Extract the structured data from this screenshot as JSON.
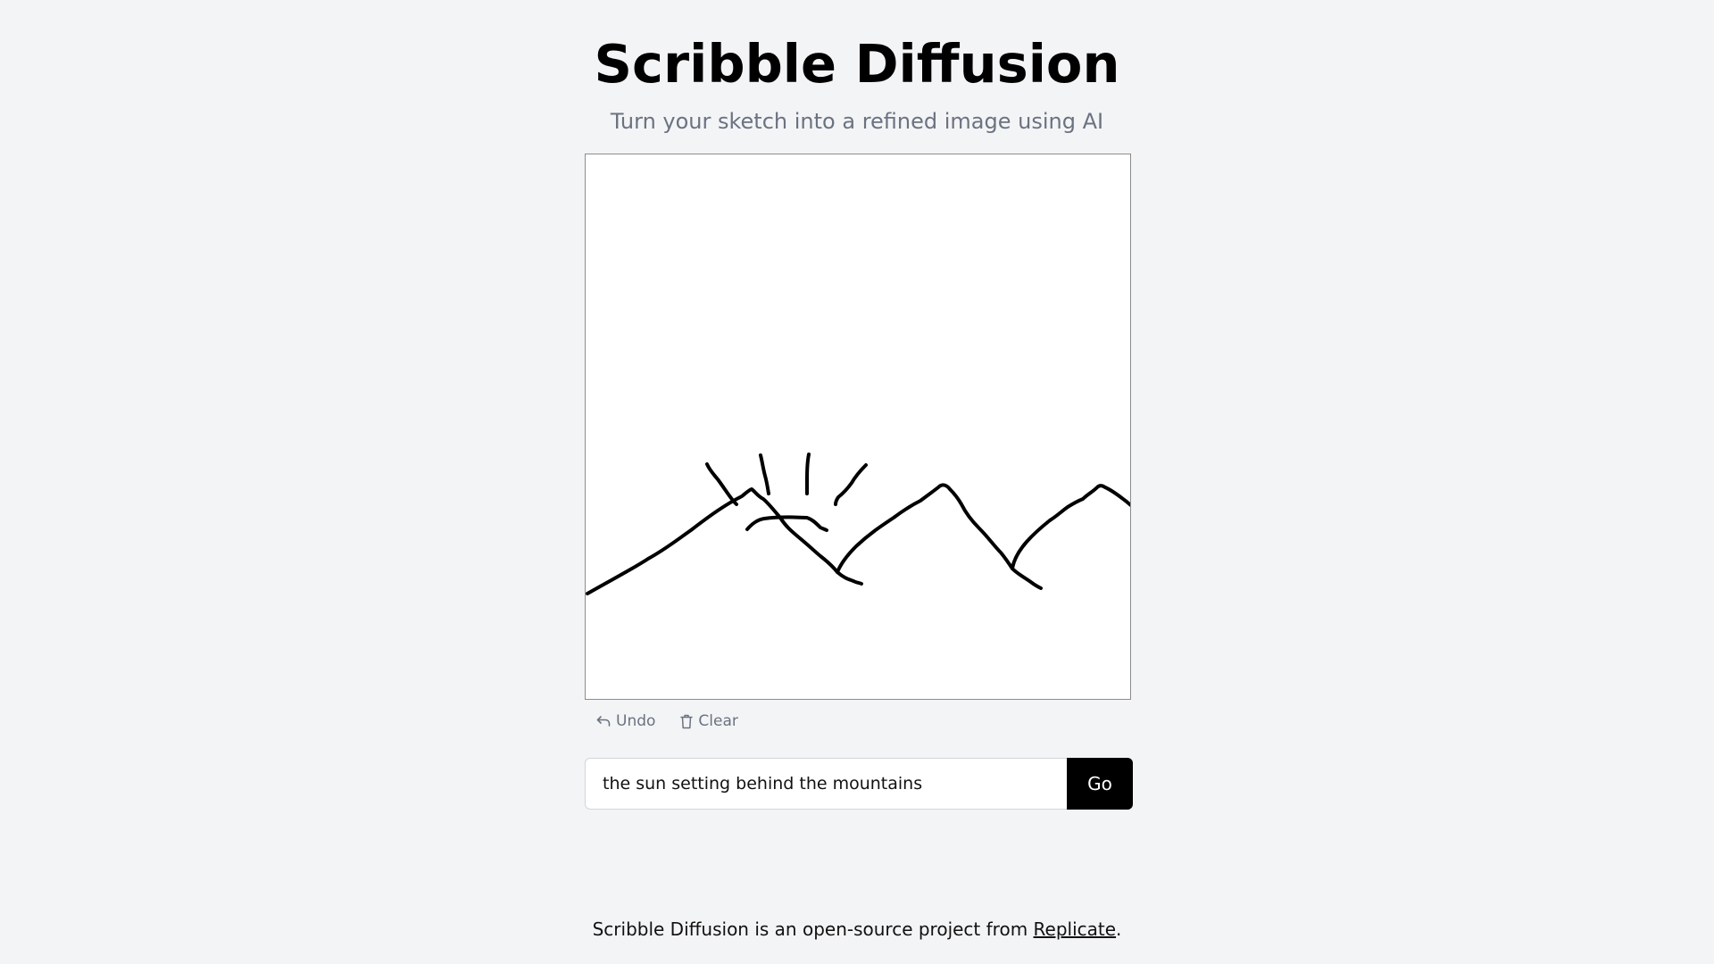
{
  "header": {
    "title": "Scribble Diffusion",
    "subtitle": "Turn your sketch into a refined image using AI"
  },
  "canvas": {
    "label": "sketch canvas",
    "stroke_color": "#000000",
    "background_color": "#ffffff"
  },
  "controls": {
    "undo_label": "Undo",
    "undo_icon": "undo-arrow-icon",
    "clear_label": "Clear",
    "clear_icon": "trash-icon"
  },
  "prompt": {
    "value": "the sun setting behind the mountains",
    "submit_label": "Go"
  },
  "footer": {
    "text_before": "Scribble Diffusion is an open-source project from ",
    "link_text": "Replicate",
    "text_after": "."
  }
}
